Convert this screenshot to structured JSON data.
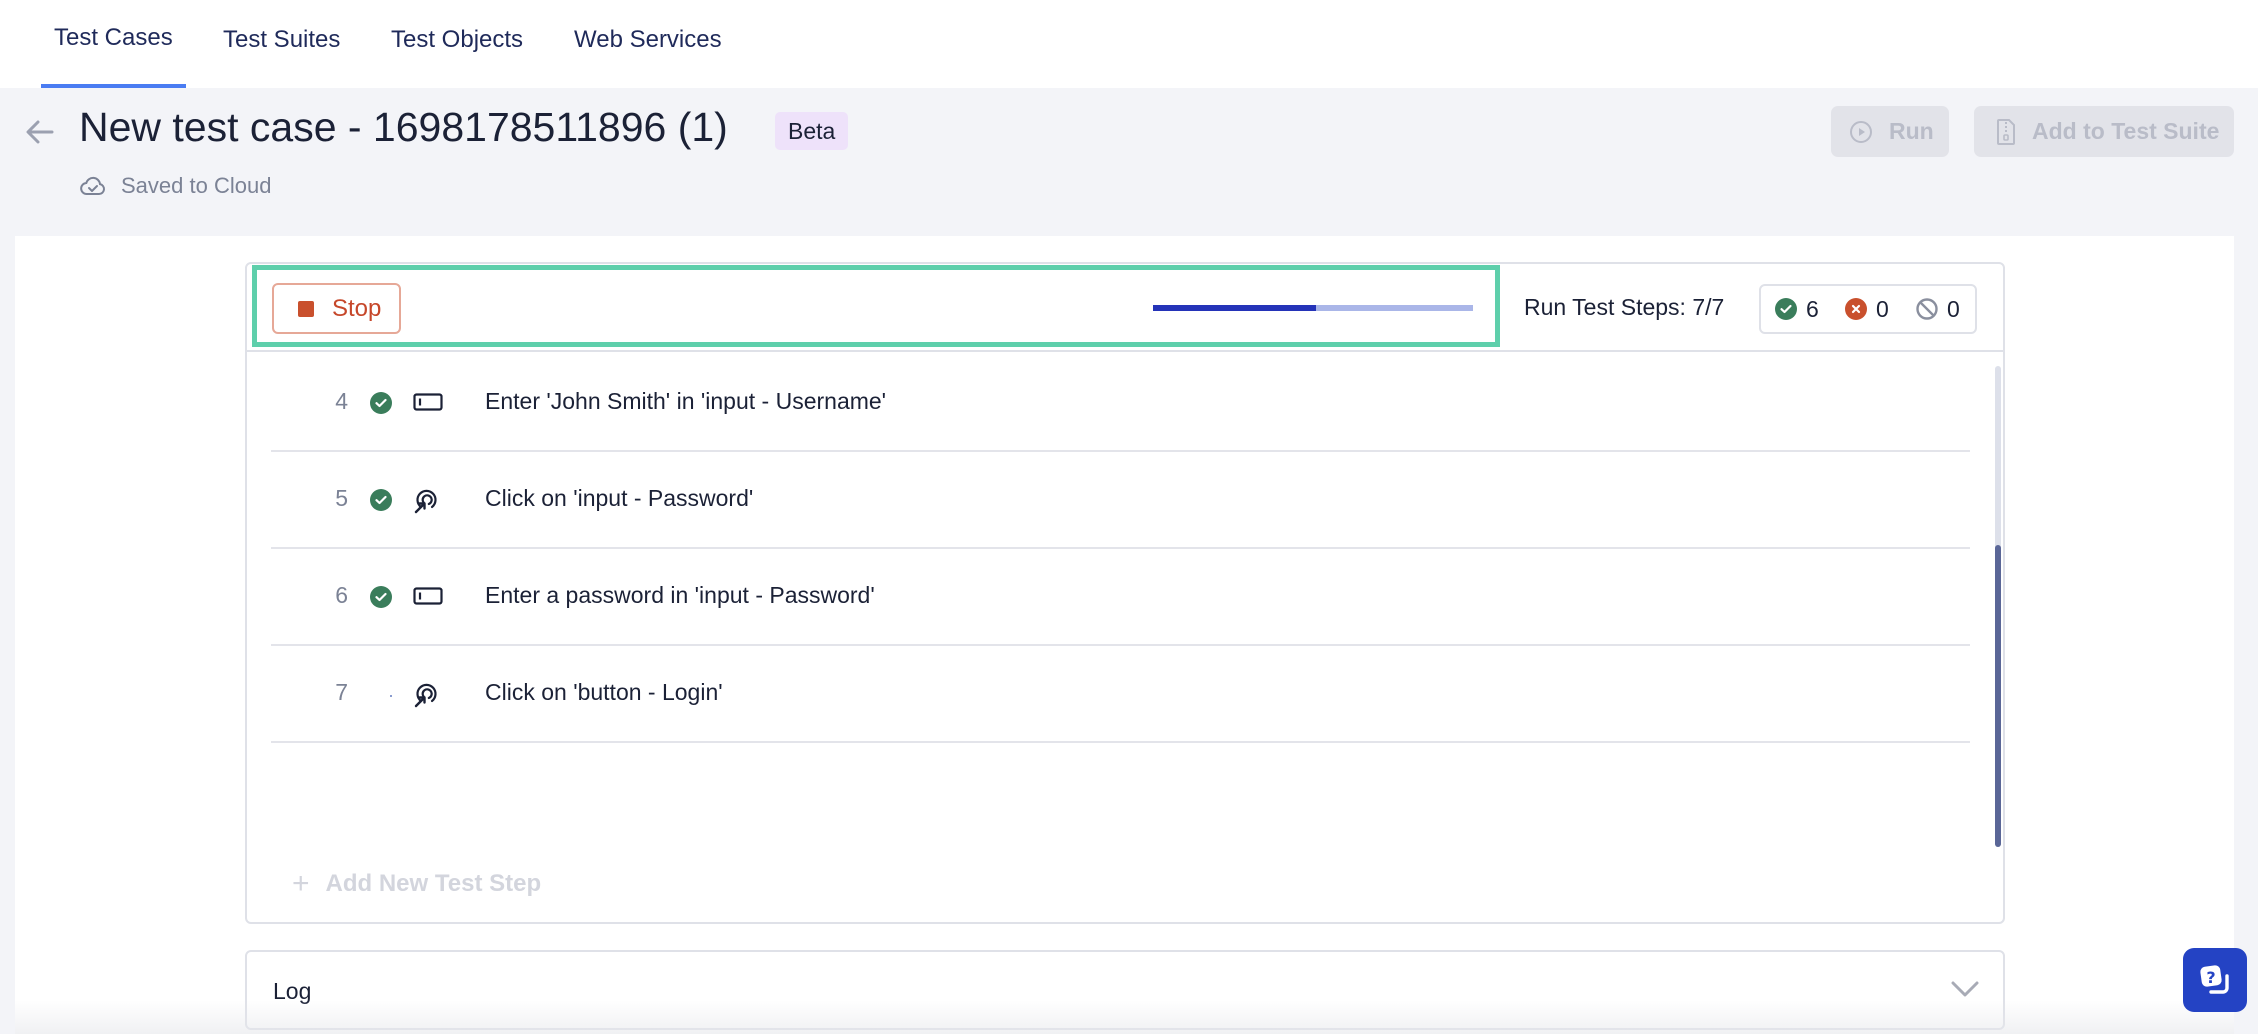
{
  "nav": {
    "tabs": [
      {
        "label": "Test Cases",
        "active": true
      },
      {
        "label": "Test Suites",
        "active": false
      },
      {
        "label": "Test Objects",
        "active": false
      },
      {
        "label": "Web Services",
        "active": false
      }
    ],
    "accent_color": "#4a7cf2"
  },
  "header": {
    "back_icon": "arrow-left-icon",
    "title": "New test case - 1698178511896 (1)",
    "badge": "Beta",
    "save_status_icon": "cloud-check-icon",
    "save_status": "Saved to Cloud",
    "run_button": {
      "label": "Run",
      "icon": "play-circle-icon",
      "disabled": true
    },
    "add_to_suite_button": {
      "label": "Add to Test Suite",
      "icon": "file-zip-icon",
      "disabled": true
    }
  },
  "run_bar": {
    "stop_button": {
      "label": "Stop",
      "icon": "stop-square-icon"
    },
    "progress_percent": 51,
    "run_steps_label": "Run Test Steps: 7/7",
    "counts": [
      {
        "icon": "check-circle-icon",
        "value": "6",
        "color": "#3a7d5b"
      },
      {
        "icon": "x-circle-icon",
        "value": "0",
        "color": "#c9502d"
      },
      {
        "icon": "ban-icon",
        "value": "0",
        "color": "#8a8f9e"
      }
    ],
    "highlight_color": "#5ecfab"
  },
  "steps": [
    {
      "number": "4",
      "status": "passed",
      "type_icon": "input-field-icon",
      "text": "Enter 'John Smith' in 'input - Username'"
    },
    {
      "number": "5",
      "status": "passed",
      "type_icon": "click-target-icon",
      "text": "Click on 'input - Password'"
    },
    {
      "number": "6",
      "status": "passed",
      "type_icon": "input-field-icon",
      "text": "Enter a password in 'input - Password'"
    },
    {
      "number": "7",
      "status": "running",
      "type_icon": "click-target-icon",
      "text": "Click on 'button - Login'"
    }
  ],
  "add_step": {
    "icon": "plus-icon",
    "label": "Add New Test Step"
  },
  "log": {
    "label": "Log",
    "icon": "chevron-down-icon"
  },
  "help_button": {
    "icon": "help-chat-icon"
  }
}
